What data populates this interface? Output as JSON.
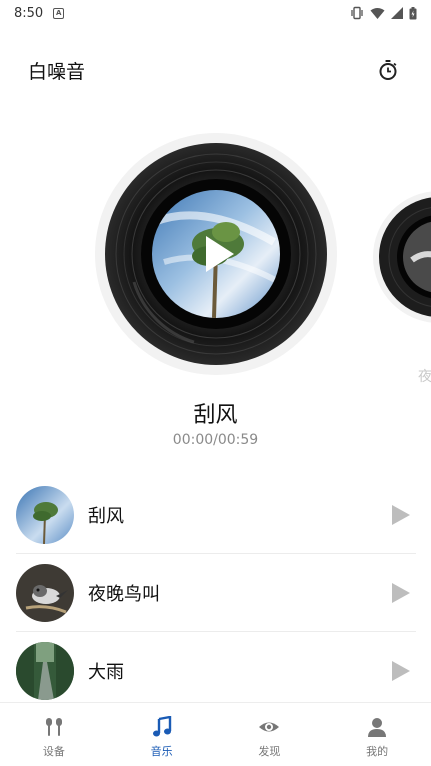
{
  "status_bar": {
    "time": "8:50",
    "left_icon": "A"
  },
  "header": {
    "title": "白噪音",
    "timer_icon": "stopwatch-icon"
  },
  "now_playing": {
    "title": "刮风",
    "time": "00:00/00:59",
    "side_label": "夜"
  },
  "sounds": [
    {
      "name": "刮风",
      "thumb": "palm-tree-sky"
    },
    {
      "name": "夜晚鸟叫",
      "thumb": "bird-on-branch"
    },
    {
      "name": "大雨",
      "thumb": "forest-road"
    }
  ],
  "tabs": [
    {
      "label": "设备",
      "icon": "earbuds-icon",
      "active": false
    },
    {
      "label": "音乐",
      "icon": "music-note-icon",
      "active": true
    },
    {
      "label": "发现",
      "icon": "eye-icon",
      "active": false
    },
    {
      "label": "我的",
      "icon": "person-icon",
      "active": false
    }
  ],
  "colors": {
    "accent": "#1a5bb5",
    "inactive": "#777777",
    "play_gray": "#bdbdbd"
  }
}
